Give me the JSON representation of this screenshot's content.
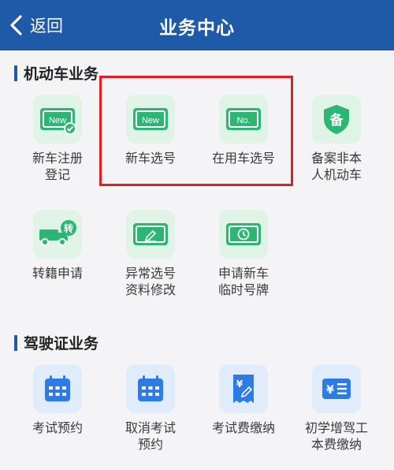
{
  "header": {
    "back_label": "返回",
    "title": "业务中心"
  },
  "colors": {
    "header_bg": "#1f5aa8",
    "green_icon": "#2bb673",
    "blue_icon": "#2f7be5",
    "highlight_border": "#e02020"
  },
  "sections": {
    "vehicle": {
      "title": "机动车业务",
      "items": [
        {
          "label": "新车注册\n登记",
          "icon": "new-plate-check-icon",
          "badge": "New"
        },
        {
          "label": "新车选号",
          "icon": "new-plate-icon",
          "badge": "New"
        },
        {
          "label": "在用车选号",
          "icon": "used-plate-icon",
          "badge": "No."
        },
        {
          "label": "备案非本\n人机动车",
          "icon": "shield-record-icon",
          "badge": "备"
        },
        {
          "label": "转籍申请",
          "icon": "truck-transfer-icon",
          "badge": "转"
        },
        {
          "label": "异常选号\n资料修改",
          "icon": "plate-edit-icon"
        },
        {
          "label": "申请新车\n临时号牌",
          "icon": "plate-clock-icon"
        }
      ]
    },
    "license": {
      "title": "驾驶证业务",
      "items": [
        {
          "label": "考试预约",
          "icon": "calendar-icon"
        },
        {
          "label": "取消考试\n预约",
          "icon": "calendar-cancel-icon"
        },
        {
          "label": "考试费缴纳",
          "icon": "receipt-pen-icon"
        },
        {
          "label": "初学增驾工\n本费缴纳",
          "icon": "yen-list-icon"
        }
      ]
    }
  }
}
